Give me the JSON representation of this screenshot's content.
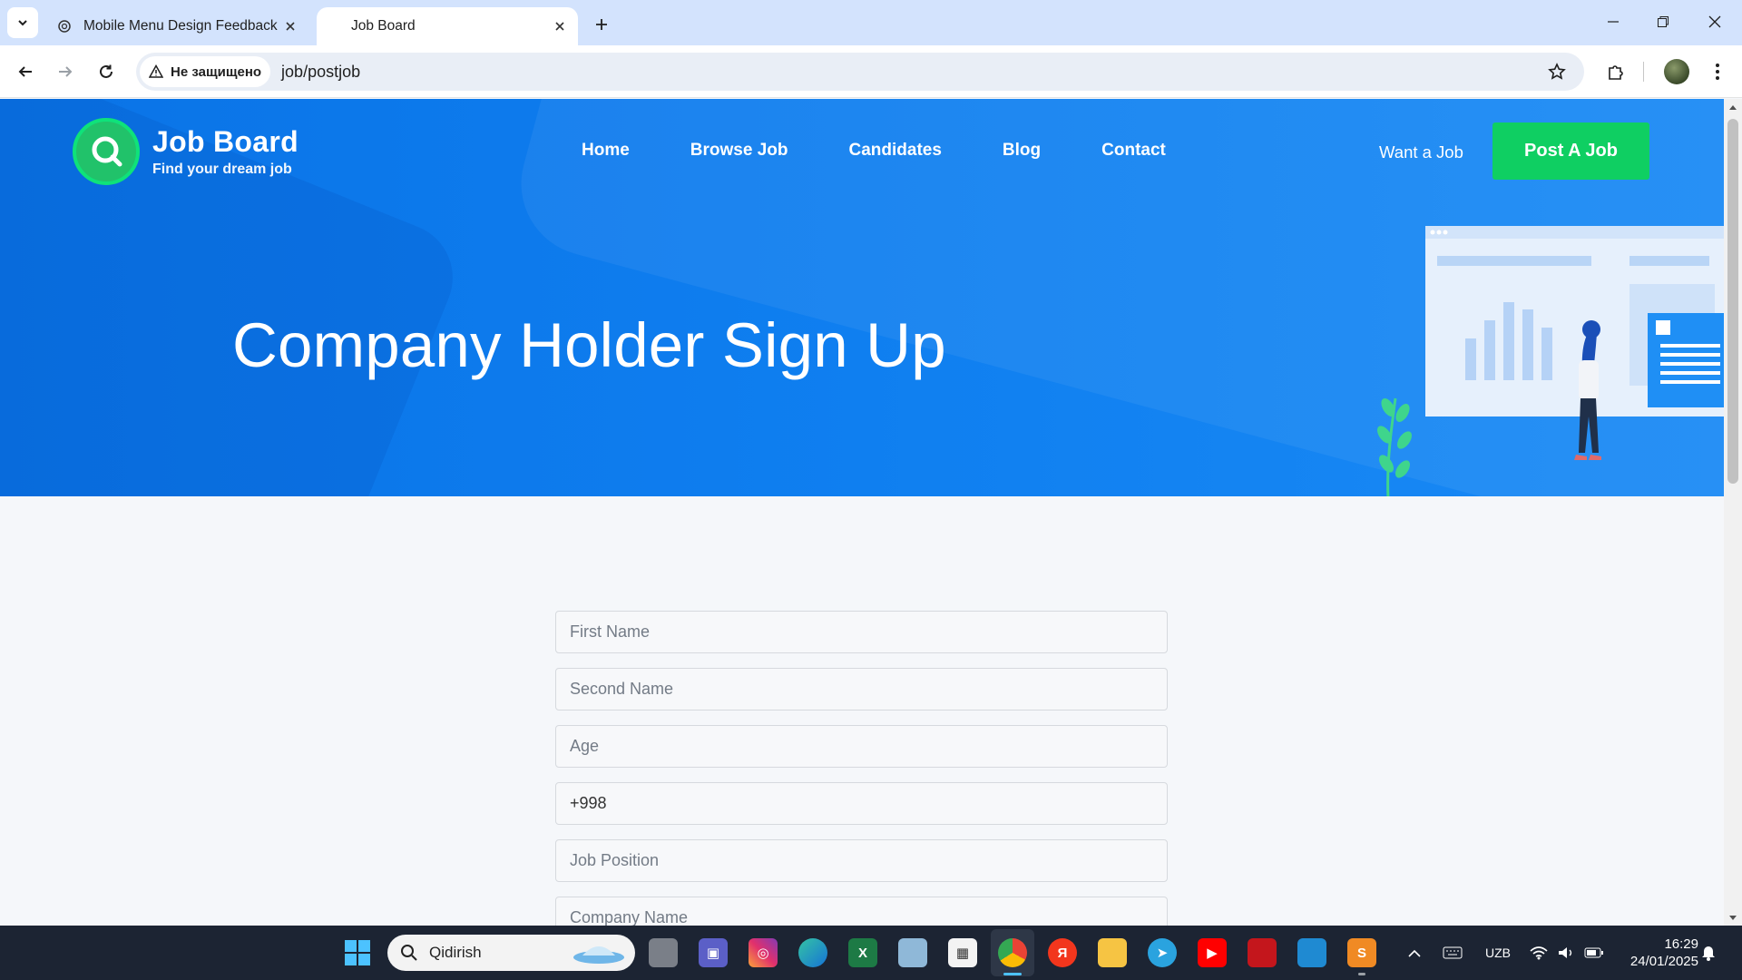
{
  "browser": {
    "tabs": [
      {
        "title": "Mobile Menu Design Feedback",
        "active": false
      },
      {
        "title": "Job Board",
        "active": true
      }
    ],
    "security_label": "Не защищено",
    "url": "job/postjob"
  },
  "site": {
    "logo_title": "Job Board",
    "logo_subtitle": "Find your dream job",
    "nav": [
      "Home",
      "Browse Job",
      "Candidates",
      "Blog",
      "Contact"
    ],
    "want_job": "Want a Job",
    "post_job": "Post A Job",
    "brand_color": "#0f7ff0",
    "accent_color": "#0fcf62"
  },
  "hero": {
    "title": "Company Holder Sign Up"
  },
  "form": {
    "first_name_placeholder": "First Name",
    "second_name_placeholder": "Second Name",
    "age_placeholder": "Age",
    "phone_value": "+998",
    "job_position_placeholder": "Job Position",
    "company_name_placeholder": "Company Name"
  },
  "taskbar": {
    "search_placeholder": "Qidirish",
    "language": "UZB",
    "time": "16:29",
    "date": "24/01/2025"
  }
}
